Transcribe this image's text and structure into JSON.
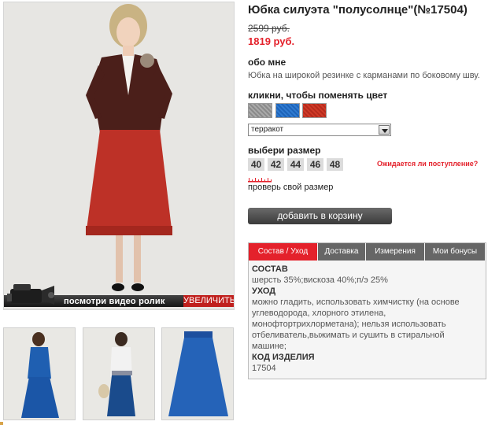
{
  "product": {
    "title": "Юбка силуэта \"полусолнце\"(№17504)",
    "old_price": "2599 руб.",
    "new_price": "1819 руб."
  },
  "about": {
    "heading": "обо мне",
    "text": "Юбка на широкой резинке с карманами по боковому шву."
  },
  "color": {
    "heading": "кликни, чтобы поменять цвет",
    "swatches": [
      "grey",
      "blue",
      "red"
    ],
    "selected": "терракот",
    "swatch_colors": [
      "#9a9a9a",
      "#2a72c6",
      "#c3321f"
    ]
  },
  "size": {
    "heading": "выбери размер",
    "options": [
      "40",
      "42",
      "44",
      "46",
      "48"
    ],
    "notify_link": "Ожидается ли поступление?",
    "check_size_link": "проверь свой размер"
  },
  "cart": {
    "button_label": "добавить в корзину"
  },
  "media": {
    "video_label": "посмотри видео ролик",
    "enlarge_label": "УВЕЛИЧИТЬ"
  },
  "tabs": [
    "Состав / Уход",
    "Доставка",
    "Измерения",
    "Мои бонусы"
  ],
  "info": {
    "composition_heading": "СОСТАВ",
    "composition_text": "шерсть 35%;вискоза 40%;п/э 25%",
    "care_heading": "УХОД",
    "care_lines": [
      "можно гладить, использовать химчистку (на основе",
      "углеводорода, хлорного этилена,",
      "монофтортрихлорметана); нельзя использовать",
      "отбеливатель,выжимать и сушить в стиральной",
      "машине;"
    ],
    "code_heading": "КОД ИЗДЕЛИЯ",
    "code_value": "17504"
  },
  "colors": {
    "accent": "#e4212b",
    "dark_button": "#4a4a4a",
    "tab_inactive": "#666666"
  }
}
